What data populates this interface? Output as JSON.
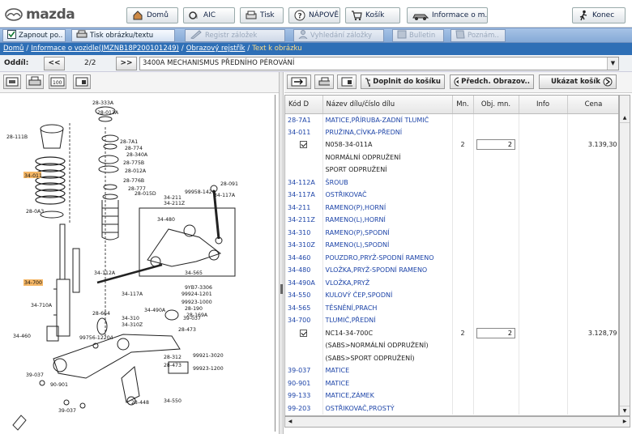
{
  "brand": {
    "name": "mazda"
  },
  "topnav": [
    {
      "label": "Domů",
      "icon": "house-icon"
    },
    {
      "label": "AIC",
      "icon": "aic-icon"
    },
    {
      "label": "Tisk",
      "icon": "print-icon"
    },
    {
      "label": "NÁPOVĚ..",
      "icon": "help-icon"
    },
    {
      "label": "Košík",
      "icon": "cart-icon"
    },
    {
      "label": "Informace o m..",
      "icon": "car-icon"
    },
    {
      "label": "Konec",
      "icon": "exit-icon"
    }
  ],
  "toolbar2": [
    {
      "label": "Zapnout po..",
      "enabled": true
    },
    {
      "label": "Tisk obrázku/textu",
      "enabled": true
    },
    {
      "label": "Registr záložek",
      "enabled": false
    },
    {
      "label": "Vyhledání záložky",
      "enabled": false
    },
    {
      "label": "Bulletin",
      "enabled": false
    },
    {
      "label": "Poznám..",
      "enabled": false
    }
  ],
  "breadcrumb": [
    "Domů",
    "Informace o vozidle(JMZNB18P200101249)",
    "Obrazový rejstřík",
    "Text k obrázku"
  ],
  "section": {
    "label": "Oddíl:",
    "prev": "<<",
    "page": "2/2",
    "next": ">>",
    "selected": "3400A  MECHANISMUS PŘEDNÍHO PÉROVÁNÍ"
  },
  "actions": {
    "add_to_cart": "Doplnit do košíku",
    "prev_image": "Předch. Obrazov..",
    "show_cart": "Ukázat košík"
  },
  "columns": [
    "Kód D",
    "Název dílu/číslo dílu",
    "Mn.",
    "Obj. mn.",
    "Info",
    "Cena"
  ],
  "rows": [
    {
      "code": "28-7A1",
      "name": "MATICE,PŘÍRUBA-ZADNÍ TLUMIČ",
      "link": true
    },
    {
      "code": "34-011",
      "name": "PRUŽINA,CÍVKA-PŘEDNÍ",
      "link": true
    },
    {
      "code": "",
      "checked": true,
      "name": "N058-34-011A",
      "qty": "2",
      "order": "2",
      "price": "3.139,30"
    },
    {
      "code": "",
      "name": "NORMÁLNÍ ODPRUŽENÍ"
    },
    {
      "code": "",
      "name": "SPORT ODPRUŽENÍ"
    },
    {
      "code": "34-112A",
      "name": "ŠROUB",
      "link": true
    },
    {
      "code": "34-117A",
      "name": "OSTŘIKOVAČ",
      "link": true
    },
    {
      "code": "34-211",
      "name": "RAMENO(P),HORNÍ",
      "link": true
    },
    {
      "code": "34-211Z",
      "name": "RAMENO(L),HORNÍ",
      "link": true
    },
    {
      "code": "34-310",
      "name": "RAMENO(P),SPODNÍ",
      "link": true
    },
    {
      "code": "34-310Z",
      "name": "RAMENO(L),SPODNÍ",
      "link": true
    },
    {
      "code": "34-460",
      "name": "POUZDRO,PRYŽ-SPODNÍ RAMENO",
      "link": true
    },
    {
      "code": "34-480",
      "name": "VLOŽKA,PRYŽ-SPODNÍ RAMENO",
      "link": true
    },
    {
      "code": "34-490A",
      "name": "VLOŽKA,PRYŽ",
      "link": true
    },
    {
      "code": "34-550",
      "name": "KULOVÝ ČEP,SPODNÍ",
      "link": true
    },
    {
      "code": "34-565",
      "name": "TĚSNĚNÍ,PRACH",
      "link": true
    },
    {
      "code": "34-700",
      "name": "TLUMIČ,PŘEDNÍ",
      "link": true
    },
    {
      "code": "",
      "checked": true,
      "name": "NC14-34-700C",
      "qty": "2",
      "order": "2",
      "price": "3.128,79"
    },
    {
      "code": "",
      "name": "(SABS>NORMÁLNÍ ODPRUŽENÍ)"
    },
    {
      "code": "",
      "name": "(SABS>SPORT ODPRUŽENÍ)"
    },
    {
      "code": "39-037",
      "name": "MATICE",
      "link": true
    },
    {
      "code": "90-901",
      "name": "MATICE",
      "link": true
    },
    {
      "code": "99-133",
      "name": "MATICE,ZÁMEK",
      "link": true
    },
    {
      "code": "99-203",
      "name": "OSTŘIKOVAČ,PROSTÝ",
      "link": true
    }
  ],
  "diagram_labels": [
    "28-333A",
    "28-013A",
    "28-111B",
    "28-7A1",
    "28-774",
    "28-340A",
    "28-775B",
    "28-012A",
    "28-776B",
    "28-777",
    "28-015D",
    "34-211",
    "34-211Z",
    "28-091",
    "34-117A",
    "99958-1420",
    "34-011",
    "28-0A3",
    "34-480",
    "34-112A",
    "34-700",
    "34-710A",
    "34-565",
    "34-117A",
    "9YB7-3306",
    "99924-1201",
    "99923-1000",
    "28-190",
    "28-169A",
    "34-490A",
    "39-037",
    "28-664",
    "34-310",
    "34-310Z",
    "28-473",
    "34-460",
    "99756-12204",
    "28-312",
    "99921-3020",
    "28-473",
    "99923-1200",
    "39-037",
    "90-901",
    "28-448",
    "34-550",
    "39-037"
  ]
}
